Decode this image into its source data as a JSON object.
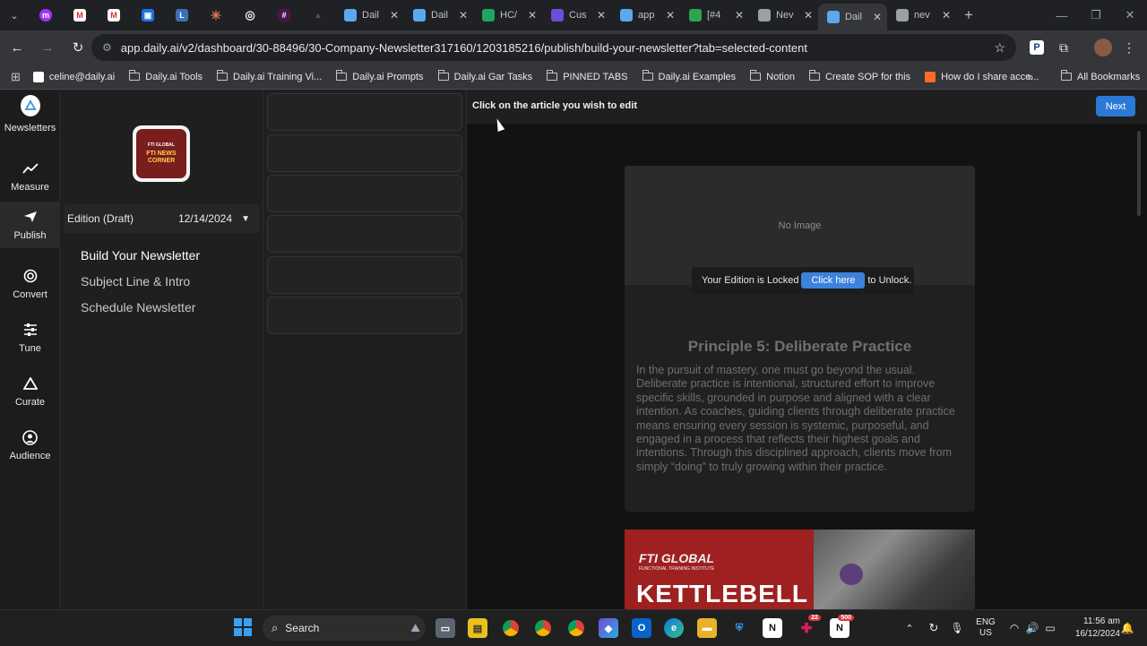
{
  "browser": {
    "tabs": [
      {
        "label": "Dail",
        "icon": "daily-ai-icon",
        "color": "#5aa9f0"
      },
      {
        "label": "Dail",
        "icon": "daily-ai-icon",
        "color": "#5aa9f0"
      },
      {
        "label": "HC/",
        "icon": "sheets-icon",
        "color": "#1fa463"
      },
      {
        "label": "Cus",
        "icon": "s-icon",
        "color": "#6d4ed8"
      },
      {
        "label": "app",
        "icon": "daily-ai-icon",
        "color": "#5aa9f0"
      },
      {
        "label": "[#4",
        "icon": "green-g-icon",
        "color": "#2ea44f"
      },
      {
        "label": "Nev",
        "icon": "globe-icon",
        "color": "#9aa0a6"
      },
      {
        "label": "Dail",
        "icon": "daily-ai-icon",
        "color": "#5aa9f0",
        "active": true
      },
      {
        "label": "nev",
        "icon": "globe-icon",
        "color": "#9aa0a6"
      }
    ],
    "url": "app.daily.ai/v2/dashboard/30-88496/30-Company-Newsletter317160/1203185216/publish/build-your-newsletter?tab=selected-content",
    "bookmarks": [
      {
        "label": "celine@daily.ai",
        "type": "gmail"
      },
      {
        "label": "Daily.ai Tools",
        "type": "folder"
      },
      {
        "label": "Daily.ai Training Vi...",
        "type": "folder"
      },
      {
        "label": "Daily.ai Prompts",
        "type": "folder"
      },
      {
        "label": "Daily.ai Gar Tasks",
        "type": "folder"
      },
      {
        "label": "PINNED TABS",
        "type": "folder"
      },
      {
        "label": "Daily.ai Examples",
        "type": "folder"
      },
      {
        "label": "Notion",
        "type": "folder"
      },
      {
        "label": "Create SOP for this",
        "type": "folder"
      },
      {
        "label": "How do I share acce...",
        "type": "site"
      }
    ],
    "all_bookmarks": "All Bookmarks",
    "overflow": "»"
  },
  "rail": {
    "items": [
      {
        "label": "Newsletters",
        "icon": "daily-logo-icon"
      },
      {
        "label": "Measure",
        "icon": "chart-line-icon"
      },
      {
        "label": "Publish",
        "icon": "paper-plane-icon",
        "active": true
      },
      {
        "label": "Convert",
        "icon": "target-icon"
      },
      {
        "label": "Tune",
        "icon": "sliders-icon"
      },
      {
        "label": "Curate",
        "icon": "triangle-logo-icon"
      },
      {
        "label": "Audience",
        "icon": "user-circle-icon"
      }
    ]
  },
  "sidemenu": {
    "logo_text_top": "FTI GLOBAL",
    "logo_text_main": "FTI NEWS CORNER",
    "edition_label": "Edition (Draft)",
    "edition_date": "12/14/2024",
    "items": [
      "Build Your Newsletter",
      "Subject Line & Intro",
      "Schedule Newsletter"
    ]
  },
  "editor": {
    "hint": "Click on the article you wish to edit",
    "next_label": "Next",
    "no_image": "No Image",
    "article_title": "Principle 5: Deliberate Practice",
    "article_body": "In the pursuit of mastery, one must go beyond the usual. Deliberate practice is intentional, structured effort to improve specific skills, grounded in purpose and aligned with a clear intention. As coaches, guiding clients through deliberate practice means ensuring every session is systemic, purposeful, and engaged in a process that reflects their highest goals and intentions. Through this disciplined approach, clients move from simply “doing” to truly growing within their practice.",
    "lock_text_before": "Your Edition is Locked",
    "lock_button": "Click here",
    "lock_text_after": "to Unlock.",
    "article2_brand": "FTI GLOBAL",
    "article2_sub": "FUNCTIONAL TRAINING INSTITUTE",
    "article2_headline": "KETTLEBELL"
  },
  "taskbar": {
    "search_label": "Search",
    "lang_top": "ENG",
    "lang_bottom": "US",
    "time": "11:56 am",
    "date": "16/12/2024",
    "badge_a": "22",
    "badge_b": "500"
  }
}
